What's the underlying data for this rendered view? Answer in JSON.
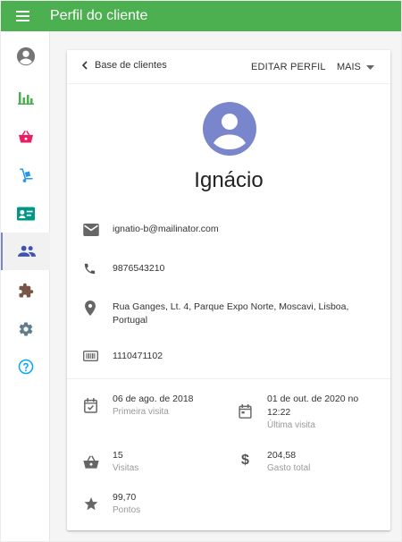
{
  "appbar": {
    "title": "Perfil do cliente",
    "menu_icon": "menu-icon",
    "color": "#4caf50"
  },
  "sidebar": {
    "items": [
      {
        "icon": "account-circle-icon",
        "color": "#757575"
      },
      {
        "icon": "bar-chart-icon",
        "color": "#4caf50"
      },
      {
        "icon": "shopping-basket-icon",
        "color": "#e91e63"
      },
      {
        "icon": "hand-truck-icon",
        "color": "#2196f3"
      },
      {
        "icon": "contact-card-icon",
        "color": "#009688"
      },
      {
        "icon": "people-icon",
        "color": "#3f51b5",
        "active": true
      },
      {
        "icon": "puzzle-icon",
        "color": "#795548"
      },
      {
        "icon": "settings-icon",
        "color": "#607d8b"
      },
      {
        "icon": "help-icon",
        "color": "#03a9f4"
      }
    ]
  },
  "toolbar": {
    "back_label": "Base de clientes",
    "edit_label": "EDITAR PERFIL",
    "more_label": "MAIS"
  },
  "customer": {
    "name": "Ignácio",
    "avatar_color": "#7986cb",
    "email": "ignatio-b@mailinator.com",
    "phone": "9876543210",
    "address_line1": "Rua Ganges, Lt. 4, Parque Expo Norte, Moscavi, Lisboa,",
    "address_line2": "Portugal",
    "id_number": "1110471102"
  },
  "stats": {
    "first_visit_value": "06 de ago. de 2018",
    "first_visit_label": "Primeira visita",
    "last_visit_value_line1": "01 de out. de 2020 no",
    "last_visit_value_line2": "12:22",
    "last_visit_label": "Última visita",
    "visits_value": "15",
    "visits_label": "Visitas",
    "spent_value": "204,58",
    "spent_label": "Gasto total",
    "points_value": "99,70",
    "points_label": "Pontos"
  }
}
